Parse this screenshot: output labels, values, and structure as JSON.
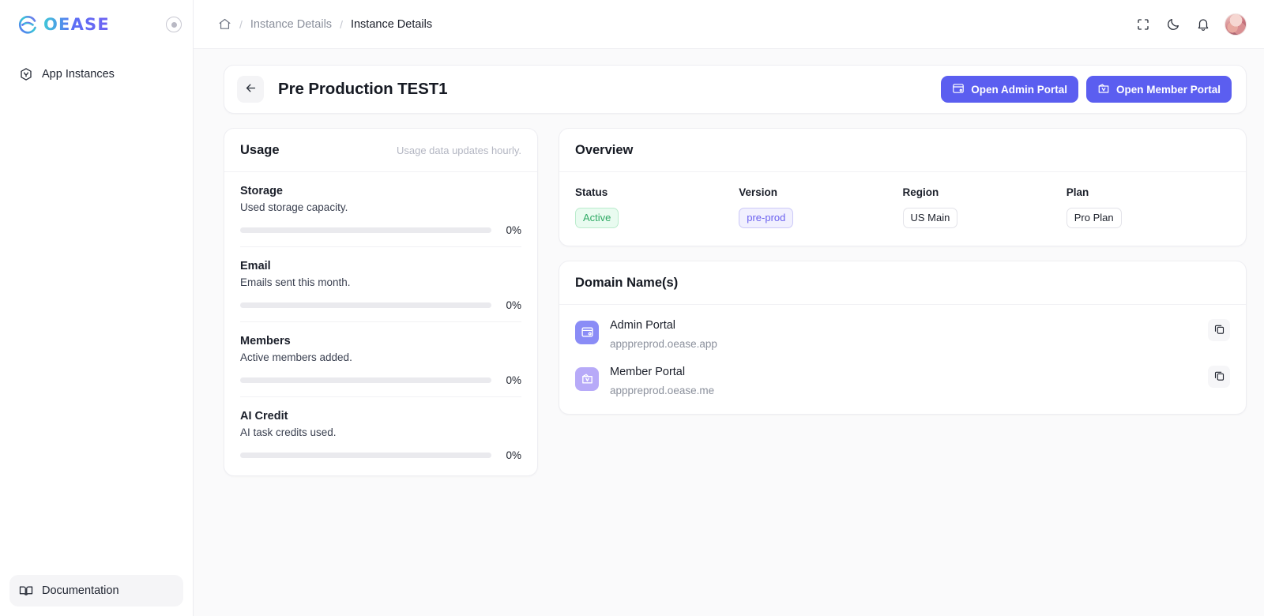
{
  "sidebar": {
    "brand": "OEASE",
    "collapse_label": "Collapse sidebar",
    "items": [
      {
        "label": "App Instances",
        "icon": "hexagon-user-icon"
      }
    ],
    "documentation": {
      "label": "Documentation",
      "icon": "book-icon"
    }
  },
  "topbar": {
    "breadcrumb": {
      "home_icon": "home-icon",
      "sep": "/",
      "parent": "Instance Details",
      "current": "Instance Details"
    },
    "icons": {
      "fullscreen": "fullscreen-icon",
      "theme": "moon-icon",
      "notifications": "bell-icon",
      "avatar": "user-avatar"
    }
  },
  "page_header": {
    "back_label": "Back",
    "title": "Pre Production TEST1",
    "actions": [
      {
        "label": "Open Admin Portal",
        "icon": "browser-window-icon"
      },
      {
        "label": "Open Member Portal",
        "icon": "id-card-icon"
      }
    ]
  },
  "usage": {
    "title": "Usage",
    "note": "Usage data updates hourly.",
    "rows": [
      {
        "name": "Storage",
        "desc": "Used storage capacity.",
        "percent": 0,
        "percent_label": "0%"
      },
      {
        "name": "Email",
        "desc": "Emails sent this month.",
        "percent": 0,
        "percent_label": "0%"
      },
      {
        "name": "Members",
        "desc": "Active members added.",
        "percent": 0,
        "percent_label": "0%"
      },
      {
        "name": "AI Credit",
        "desc": "AI task credits used.",
        "percent": 0,
        "percent_label": "0%"
      }
    ]
  },
  "overview": {
    "title": "Overview",
    "fields": [
      {
        "label": "Status",
        "value": "Active",
        "style": "green"
      },
      {
        "label": "Version",
        "value": "pre-prod",
        "style": "purple"
      },
      {
        "label": "Region",
        "value": "US Main",
        "style": "plain"
      },
      {
        "label": "Plan",
        "value": "Pro Plan",
        "style": "plain"
      }
    ]
  },
  "domains": {
    "title": "Domain Name(s)",
    "rows": [
      {
        "name": "Admin Portal",
        "url": "apppreprod.oease.app",
        "icon": "admin-portal-icon",
        "copy_label": "Copy"
      },
      {
        "name": "Member Portal",
        "url": "apppreprod.oease.me",
        "icon": "member-portal-icon",
        "copy_label": "Copy"
      }
    ]
  },
  "colors": {
    "accent": "#5b5ef0",
    "accent_alt": "#8a8cf6",
    "success": "#2faa65",
    "page_bg": "#fafafb",
    "card_bg": "#ffffff",
    "border": "#eeeef2"
  }
}
